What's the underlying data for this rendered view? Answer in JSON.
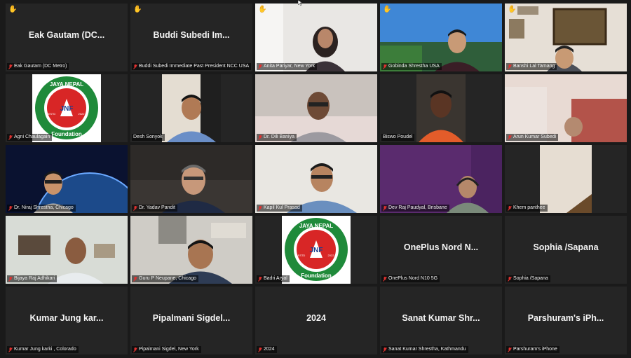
{
  "meeting": {
    "participants": [
      {
        "label": "Eak Gautam (DC Metro)",
        "center": "Eak Gautam (DC...",
        "hand": true
      },
      {
        "label": "Buddi Subedi Immediate Past President NCC USA",
        "center": "Buddi Subedi Im...",
        "hand": true
      },
      {
        "label": "Anita Pariyar, New York",
        "hand": true
      },
      {
        "label": "Gobinda Shrestha USA",
        "hand": true
      },
      {
        "label": "Banshi Lal Tamang",
        "hand": true
      },
      {
        "label": "Agni Chaulagain"
      },
      {
        "label": "Desh Sonyok"
      },
      {
        "label": "Dr. Dili Baniya"
      },
      {
        "label": "Biswo Poudel"
      },
      {
        "label": "Arun Kumar Subedi"
      },
      {
        "label": "Dr. Niraj Shrestha, Chicago"
      },
      {
        "label": "Dr. Yadav Pandit"
      },
      {
        "label": "Kapil Kul Prasad"
      },
      {
        "label": "Dev Raj Paudyal, Brisbane"
      },
      {
        "label": "Khem panthee"
      },
      {
        "label": "Bijaya Raj Adhikari"
      },
      {
        "label": "Guru P Neupane, Chicago"
      },
      {
        "label": "Badri Aryal"
      },
      {
        "label": "OnePlus Nord N10 5G",
        "center": "OnePlus Nord N..."
      },
      {
        "label": "Sophia /Sapana",
        "center": "Sophia /Sapana"
      },
      {
        "label": "Kumar Jung karki , Colorado",
        "center": "Kumar Jung kar..."
      },
      {
        "label": "Pipalmani Sigdel, New York",
        "center": "Pipalmani Sigdel..."
      },
      {
        "label": "2024",
        "center": "2024"
      },
      {
        "label": "Sanat Kumar Shrestha, Kathmandu",
        "center": "Sanat Kumar Shr..."
      },
      {
        "label": "Parshuram's iPhone",
        "center": "Parshuram's iPh..."
      }
    ],
    "logo": {
      "top": "JAYA NEPAL",
      "mid": "JNF",
      "estd": "ESTD",
      "year": "2022",
      "bottom": "Foundation"
    },
    "colors": {
      "mic_muted": "#e0312f",
      "active_speaker": "#c8d45a",
      "raised_hand": "#f5c242",
      "tile_bg": "#252525",
      "logo_green": "#1f8a3a",
      "logo_red": "#d82626",
      "logo_blue": "#1a3d8f"
    }
  }
}
